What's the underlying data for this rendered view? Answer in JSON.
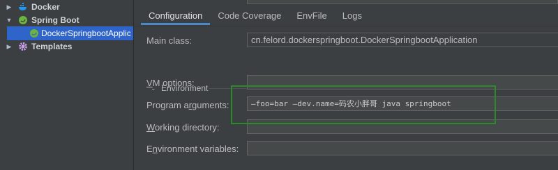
{
  "tree": {
    "items": [
      {
        "label": "Docker",
        "arrow": "▶",
        "icon": "docker-icon"
      },
      {
        "label": "Spring Boot",
        "arrow": "▼",
        "icon": "spring-boot-icon"
      },
      {
        "label": "DockerSpringbootApplic",
        "icon": "spring-app-icon"
      },
      {
        "label": "Templates",
        "arrow": "▶",
        "icon": "gear-icon"
      }
    ]
  },
  "tabs": [
    "Configuration",
    "Code Coverage",
    "EnvFile",
    "Logs"
  ],
  "form": {
    "main_class_label": "Main class:",
    "main_class_value": "cn.felord.dockerspringboot.DockerSpringbootApplication",
    "environment_section": "Environment",
    "vm_options_label_first": "V",
    "vm_options_label_rest": "M options:",
    "vm_options_value": "",
    "program_args_label_pre": "Program a",
    "program_args_label_u": "r",
    "program_args_label_post": "guments:",
    "program_args_value": "—foo=bar —dev.name=码农小胖哥  java  springboot",
    "working_dir_label_first": "W",
    "working_dir_label_rest": "orking directory:",
    "working_dir_value": "",
    "env_vars_label_pre": "E",
    "env_vars_label_u": "n",
    "env_vars_label_post": "vironment variables:",
    "env_vars_value": ""
  },
  "colors": {
    "background": "#3c3f41",
    "selection": "#2f65ca",
    "tab_underline": "#4a88c7",
    "highlight_box": "#2b8a2b"
  }
}
